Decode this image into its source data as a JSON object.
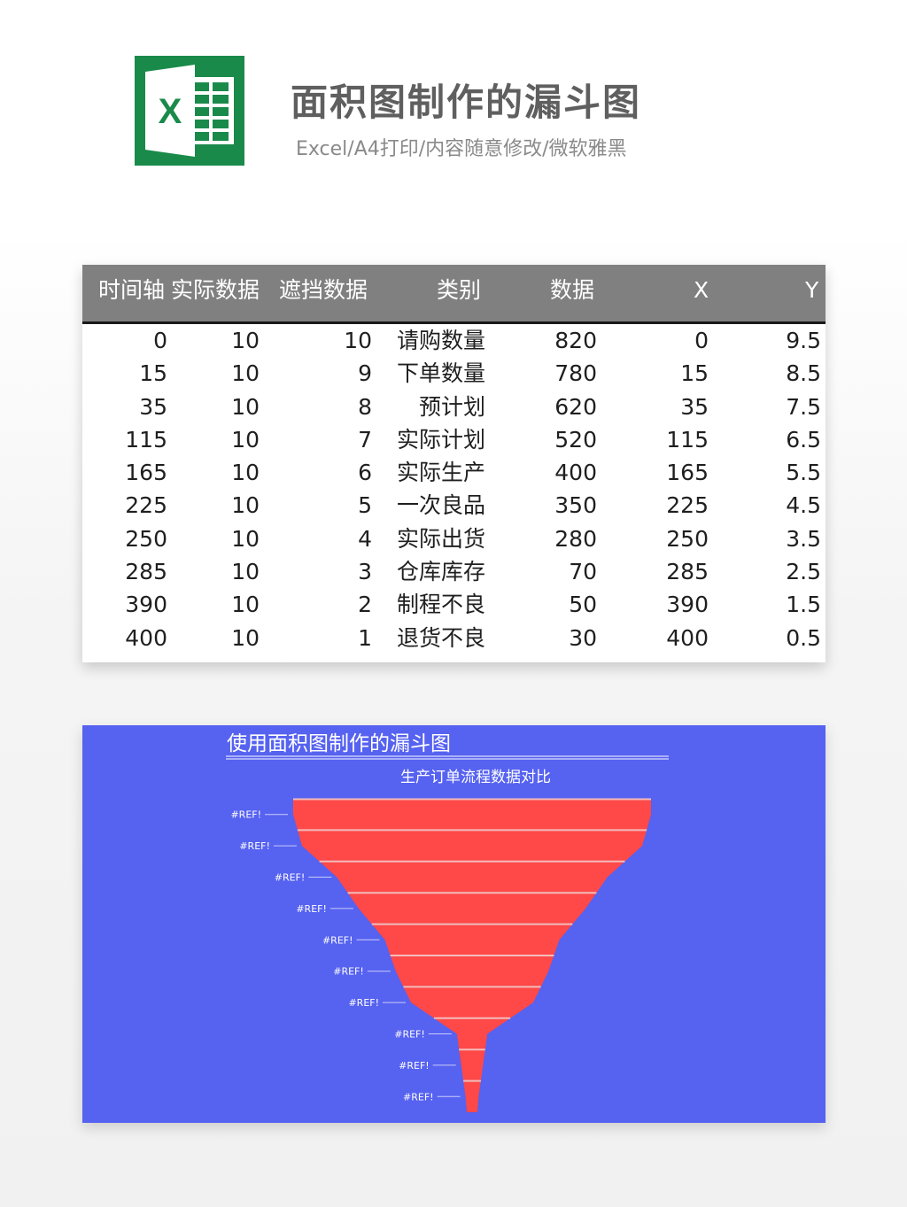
{
  "header": {
    "title": "面积图制作的漏斗图",
    "subtitle": "Excel/A4打印/内容随意修改/微软雅黑",
    "logo_letter": "X"
  },
  "table": {
    "columns": [
      "时间轴",
      "实际数据",
      "遮挡数据",
      "类别",
      "数据",
      "X",
      "Y"
    ],
    "rows": [
      [
        "0",
        "10",
        "10",
        "请购数量",
        "820",
        "0",
        "9.5"
      ],
      [
        "15",
        "10",
        "9",
        "下单数量",
        "780",
        "15",
        "8.5"
      ],
      [
        "35",
        "10",
        "8",
        "预计划",
        "620",
        "35",
        "7.5"
      ],
      [
        "115",
        "10",
        "7",
        "实际计划",
        "520",
        "115",
        "6.5"
      ],
      [
        "165",
        "10",
        "6",
        "实际生产",
        "400",
        "165",
        "5.5"
      ],
      [
        "225",
        "10",
        "5",
        "一次良品",
        "350",
        "225",
        "4.5"
      ],
      [
        "250",
        "10",
        "4",
        "实际出货",
        "280",
        "250",
        "3.5"
      ],
      [
        "285",
        "10",
        "3",
        "仓库库存",
        "70",
        "285",
        "2.5"
      ],
      [
        "390",
        "10",
        "2",
        "制程不良",
        "50",
        "390",
        "1.5"
      ],
      [
        "400",
        "10",
        "1",
        "退货不良",
        "30",
        "400",
        "0.5"
      ]
    ]
  },
  "chart_data": {
    "type": "area",
    "title": "使用面积图制作的漏斗图",
    "subtitle": "生产订单流程数据对比",
    "categories": [
      "请购数量",
      "下单数量",
      "预计划",
      "实际计划",
      "实际生产",
      "一次良品",
      "实际出货",
      "仓库库存",
      "制程不良",
      "退货不良"
    ],
    "values": [
      820,
      780,
      620,
      520,
      400,
      350,
      280,
      70,
      50,
      30
    ],
    "data_labels": [
      "#REF!",
      "#REF!",
      "#REF!",
      "#REF!",
      "#REF!",
      "#REF!",
      "#REF!",
      "#REF!",
      "#REF!",
      "#REF!"
    ],
    "max_value": 820,
    "colors": {
      "background": "#5662f0",
      "fill": "#ff4848",
      "separator": "#f2bcbc",
      "text": "#ffffff"
    }
  }
}
